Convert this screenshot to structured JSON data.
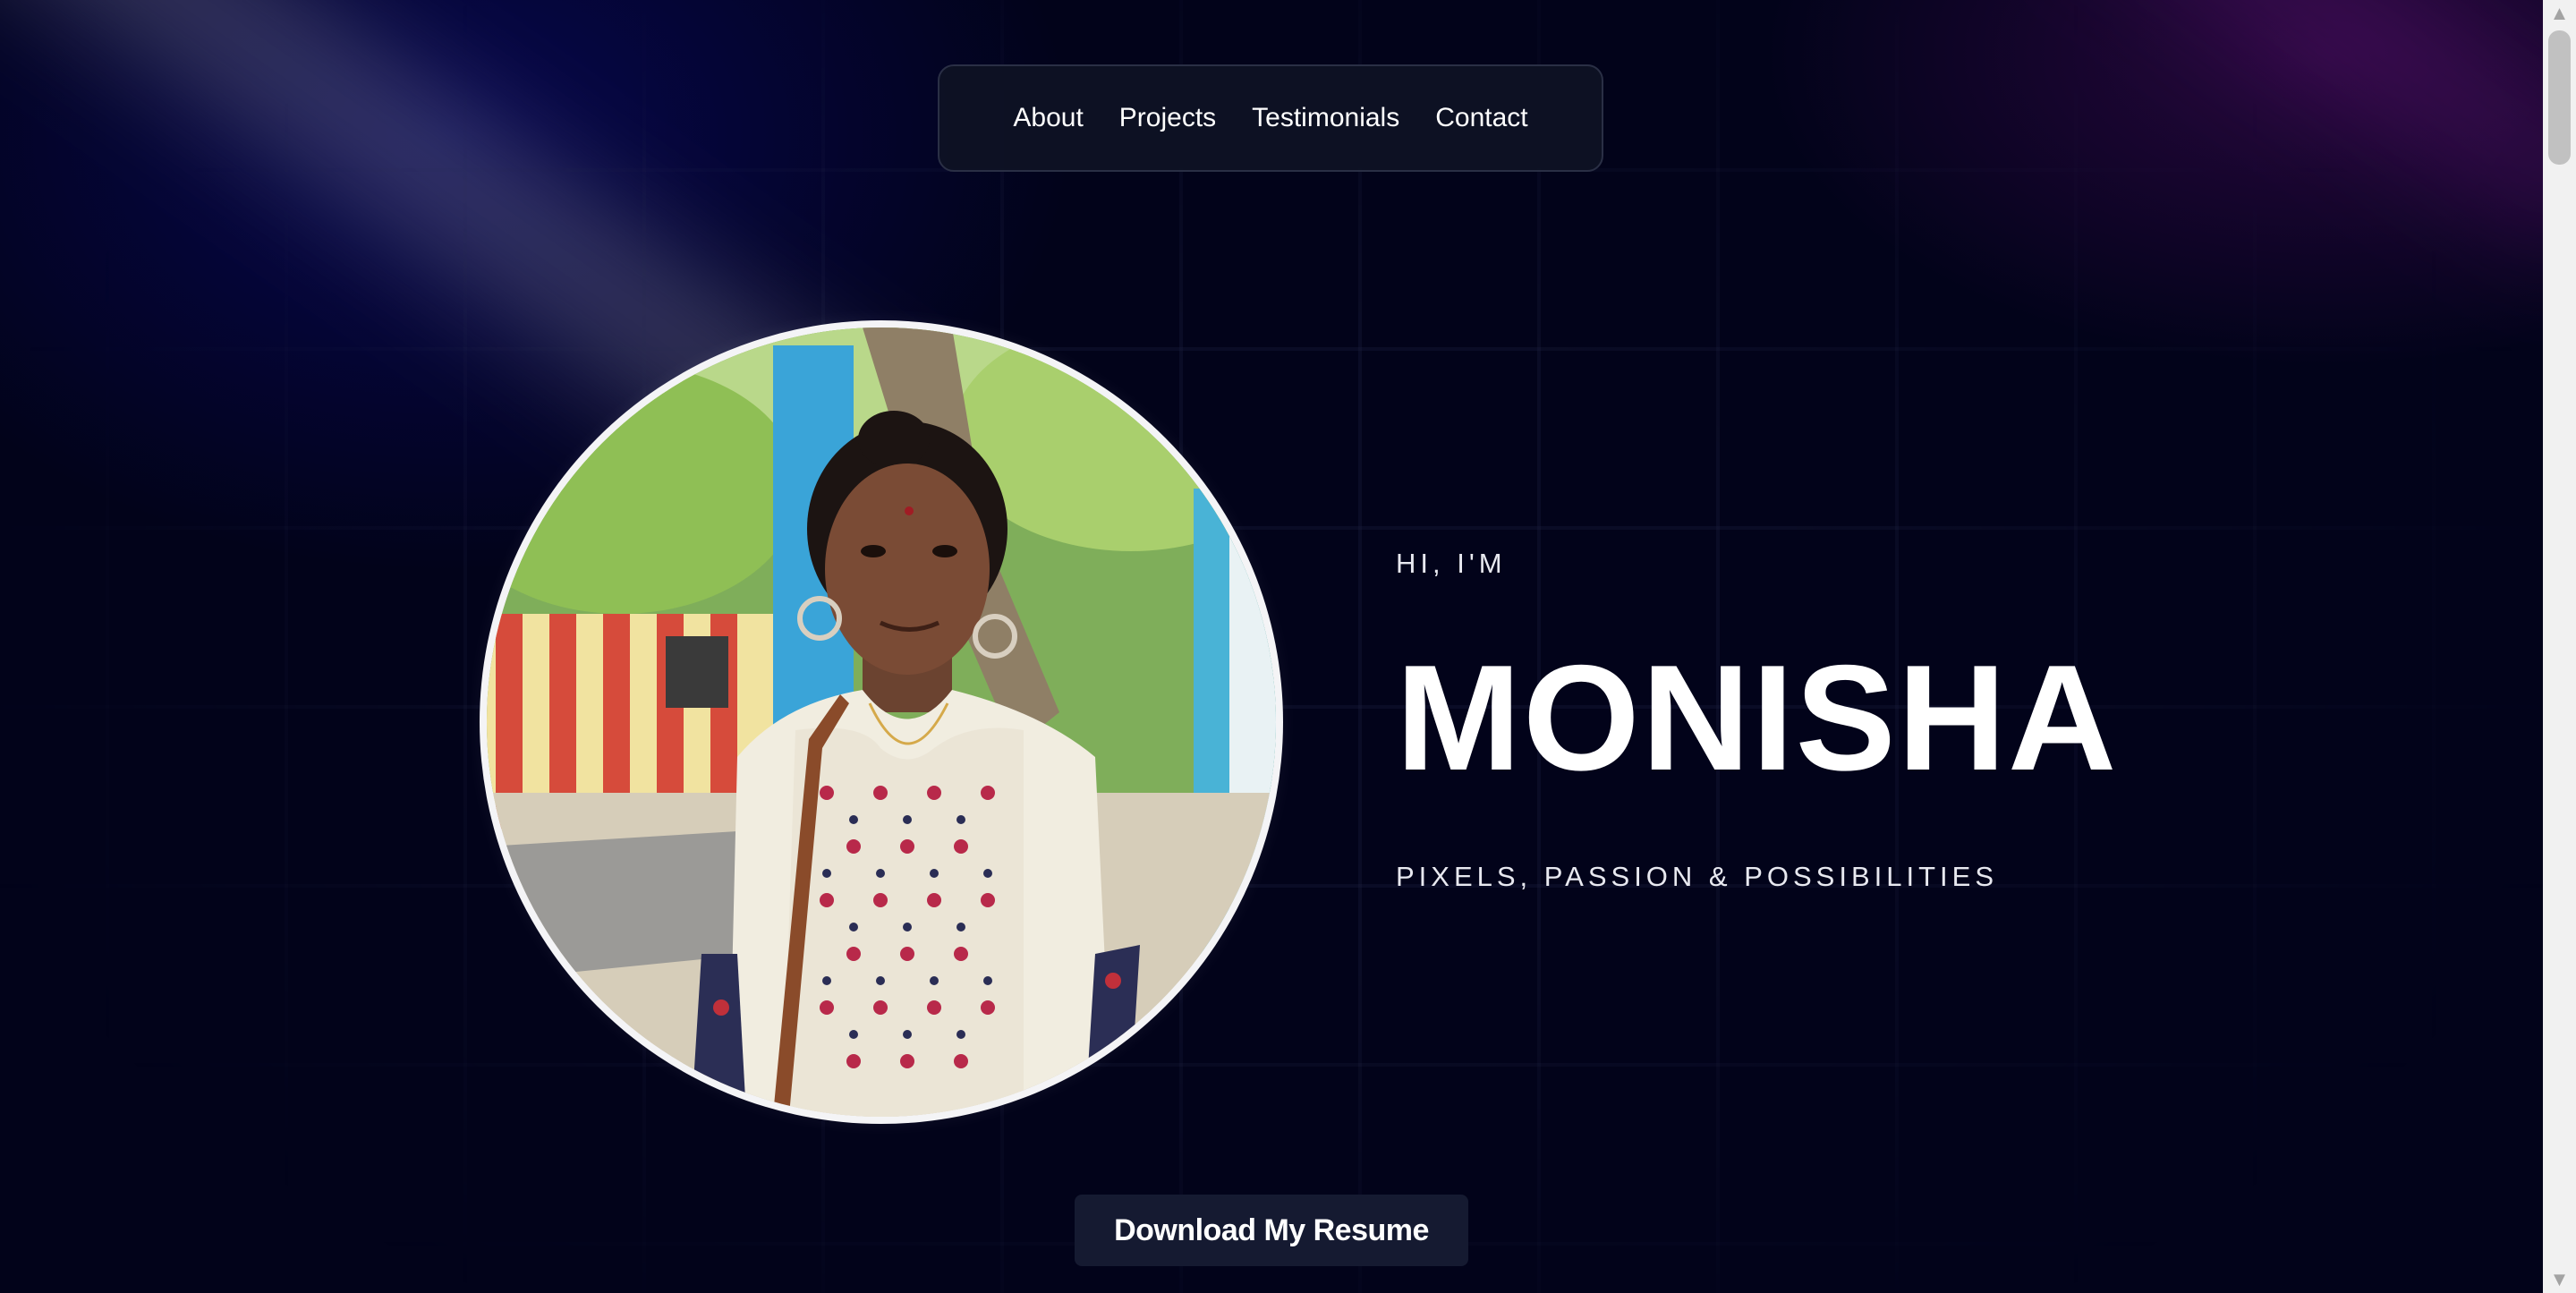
{
  "nav": {
    "items": [
      "About",
      "Projects",
      "Testimonials",
      "Contact"
    ]
  },
  "hero": {
    "intro": "HI, I'M",
    "name": "MONISHA",
    "tagline": "PIXELS, PASSION & POSSIBILITIES",
    "photo_alt": "Portrait photo of Monisha",
    "resume_button": "Download My Resume"
  },
  "colors": {
    "background": "#02031a",
    "nav_background": "#0e1224",
    "button_background": "#151a31",
    "text": "#ffffff"
  },
  "icons": {
    "scroll_up": "scroll-up-arrow-icon",
    "scroll_down": "scroll-down-arrow-icon"
  }
}
